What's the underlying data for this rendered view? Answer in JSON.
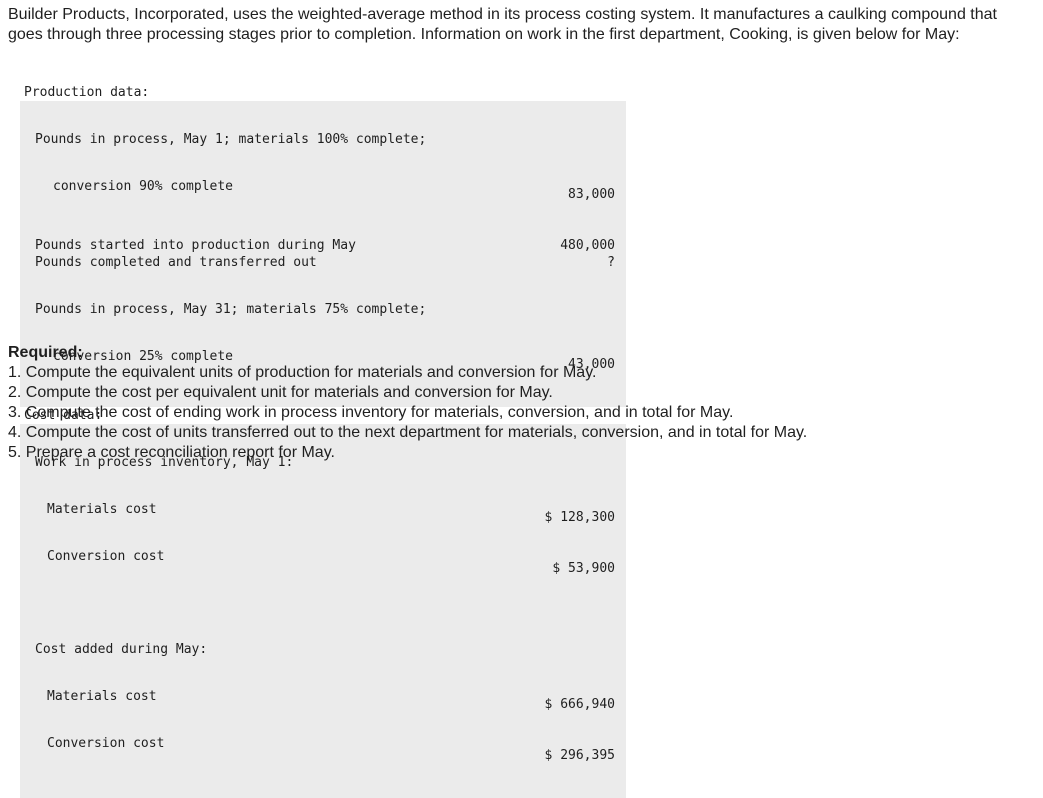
{
  "intro": "Builder Products, Incorporated, uses the weighted-average method in its process costing system. It manufactures a caulking compound that goes through three processing stages prior to completion. Information on work in the first department, Cooking, is given below for May:",
  "table": {
    "production_header": "Production data:",
    "r1_line1": "Pounds in process, May 1; materials 100% complete;",
    "r1_line2": "conversion 90% complete",
    "r1_value": "83,000",
    "r2_label": "Pounds started into production during May",
    "r2_value": "480,000",
    "r3_label": "Pounds completed and transferred out",
    "r3_value": "?",
    "r4_line1": "Pounds in process, May 31; materials 75% complete;",
    "r4_line2": "conversion 25% complete",
    "r4_value": "43,000",
    "cost_header": "Cost data:",
    "wip_header": "Work in process inventory, May 1:",
    "wip_materials_label": "Materials cost",
    "wip_materials_value": "$ 128,300",
    "wip_conversion_label": "Conversion cost",
    "wip_conversion_value": "$ 53,900",
    "added_header": "Cost added during May:",
    "added_materials_label": "Materials cost",
    "added_materials_value": "$ 666,940",
    "added_conversion_label": "Conversion cost",
    "added_conversion_value": "$ 296,395"
  },
  "required": {
    "heading": "Required:",
    "items": [
      "1. Compute the equivalent units of production for materials and conversion for May.",
      "2. Compute the cost per equivalent unit for materials and conversion for May.",
      "3. Compute the cost of ending work in process inventory for materials, conversion, and in total for May.",
      "4. Compute the cost of units transferred out to the next department for materials, conversion, and in total for May.",
      "5. Prepare a cost reconciliation report for May."
    ]
  }
}
